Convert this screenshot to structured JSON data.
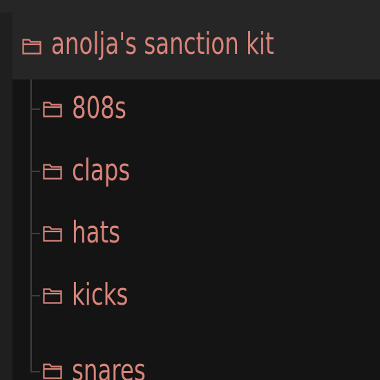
{
  "tree": {
    "root": {
      "label": "anolja's sanction kit",
      "icon": "folder-icon"
    },
    "children": [
      {
        "label": "808s",
        "icon": "folder-icon"
      },
      {
        "label": "claps",
        "icon": "folder-icon"
      },
      {
        "label": "hats",
        "icon": "folder-icon"
      },
      {
        "label": "kicks",
        "icon": "folder-icon"
      },
      {
        "label": "snares",
        "icon": "folder-icon"
      }
    ]
  },
  "colors": {
    "text_accent": "#d9847a",
    "root_row_bg": "#262626",
    "panel_bg": "#141414",
    "tree_line": "#3e3e3e"
  }
}
